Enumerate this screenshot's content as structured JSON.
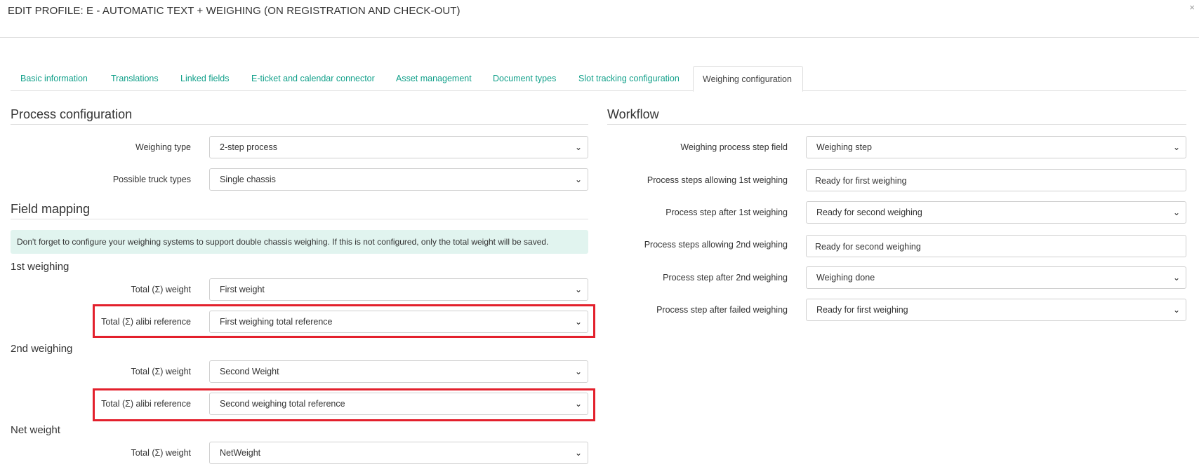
{
  "modal": {
    "title": "EDIT PROFILE: E - AUTOMATIC TEXT + WEIGHING (ON REGISTRATION AND CHECK-OUT)",
    "close_glyph": "×"
  },
  "tabs": [
    {
      "label": "Basic information"
    },
    {
      "label": "Translations"
    },
    {
      "label": "Linked fields"
    },
    {
      "label": "E-ticket and calendar connector"
    },
    {
      "label": "Asset management"
    },
    {
      "label": "Document types"
    },
    {
      "label": "Slot tracking configuration"
    },
    {
      "label": "Weighing configuration",
      "active": true
    }
  ],
  "process_config": {
    "title": "Process configuration",
    "weighing_type": {
      "label": "Weighing type",
      "value": "2-step process"
    },
    "truck_types": {
      "label": "Possible truck types",
      "value": "Single chassis"
    }
  },
  "field_mapping": {
    "title": "Field mapping",
    "alert": "Don't forget to configure your weighing systems to support double chassis weighing. If this is not configured, only the total weight will be saved.",
    "first": {
      "title": "1st weighing",
      "weight": {
        "label": "Total (Σ) weight",
        "value": "First weight"
      },
      "alibi": {
        "label": "Total (Σ) alibi reference",
        "value": "First weighing total reference"
      }
    },
    "second": {
      "title": "2nd weighing",
      "weight": {
        "label": "Total (Σ) weight",
        "value": "Second Weight"
      },
      "alibi": {
        "label": "Total (Σ) alibi reference",
        "value": "Second weighing total reference"
      }
    },
    "net": {
      "title": "Net weight",
      "weight": {
        "label": "Total (Σ) weight",
        "value": "NetWeight"
      }
    }
  },
  "workflow": {
    "title": "Workflow",
    "step_field": {
      "label": "Weighing process step field",
      "value": "Weighing step"
    },
    "allow_first": {
      "label": "Process steps allowing 1st weighing",
      "value": "Ready for first weighing"
    },
    "after_first": {
      "label": "Process step after 1st weighing",
      "value": "Ready for second weighing"
    },
    "allow_second": {
      "label": "Process steps allowing 2nd weighing",
      "value": "Ready for second weighing"
    },
    "after_second": {
      "label": "Process step after 2nd weighing",
      "value": "Weighing done"
    },
    "after_failed": {
      "label": "Process step after failed weighing",
      "value": "Ready for first weighing"
    }
  },
  "icons": {
    "dropdown": "chevron-down-icon",
    "close": "close-icon"
  },
  "colors": {
    "accent": "#11a08a",
    "alert_bg": "#e1f4ef",
    "highlight": "#e3202c"
  }
}
